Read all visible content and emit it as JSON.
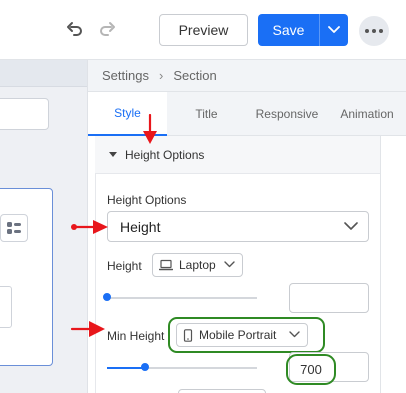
{
  "toolbar": {
    "undo_icon": "undo-icon",
    "redo_icon": "redo-icon",
    "preview_label": "Preview",
    "save_label": "Save",
    "save_menu_icon": "chevron-down-icon",
    "more_icon": "more-horizontal-icon"
  },
  "breadcrumb": {
    "root": "Settings",
    "separator": "›",
    "current": "Section"
  },
  "tabs": [
    {
      "label": "Style",
      "active": true
    },
    {
      "label": "Title",
      "active": false
    },
    {
      "label": "Responsive",
      "active": false
    },
    {
      "label": "Animation",
      "active": false
    }
  ],
  "section": {
    "title": "Height Options",
    "expanded": true
  },
  "fields": {
    "height_options": {
      "label": "Height Options",
      "value": "Height"
    },
    "height": {
      "label": "Height",
      "device": "Laptop",
      "device_icon": "laptop-icon",
      "slider_level": 0,
      "value": ""
    },
    "min_height": {
      "label": "Min Height",
      "device": "Mobile Portrait",
      "device_icon": "mobile-icon",
      "slider_level": 0.25,
      "value": "700"
    }
  },
  "colors": {
    "accent": "#1a6ff5",
    "annotation_arrow": "#e8161b",
    "annotation_highlight": "#2f8a24"
  }
}
